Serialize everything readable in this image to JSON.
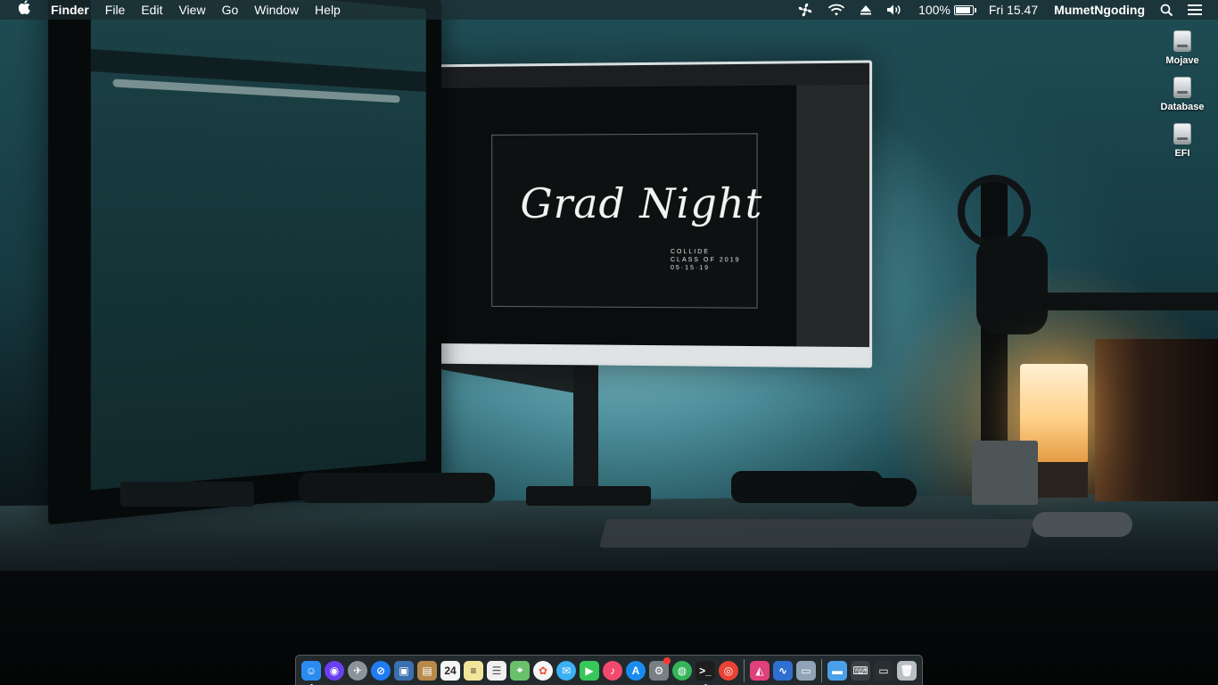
{
  "menubar": {
    "apple_icon": "apple-icon",
    "app_name": "Finder",
    "menus": [
      "File",
      "Edit",
      "View",
      "Go",
      "Window",
      "Help"
    ],
    "status": {
      "battery_percent": "100%",
      "clock": "Fri 15.47",
      "user": "MumetNgoding"
    }
  },
  "desktop": {
    "icons": [
      {
        "label": "Mojave",
        "icon": "hard-drive-icon"
      },
      {
        "label": "Database",
        "icon": "hard-drive-icon"
      },
      {
        "label": "EFI",
        "icon": "hard-drive-icon"
      }
    ]
  },
  "wallpaper": {
    "headline": "Grad Night",
    "line1": "COLLIDE",
    "line2": "CLASS OF 2019",
    "line3": "05·15·19"
  },
  "dock": {
    "apps": [
      {
        "name": "finder",
        "color": "#2b8cf0",
        "glyph": "☺",
        "running": true
      },
      {
        "name": "siri",
        "color": "#6a3ff0",
        "glyph": "◉",
        "round": true
      },
      {
        "name": "launchpad",
        "color": "#8b949b",
        "glyph": "✈",
        "round": true
      },
      {
        "name": "safari",
        "color": "#1f7bf2",
        "glyph": "⊘",
        "round": true
      },
      {
        "name": "preview",
        "color": "#3a6fb0",
        "glyph": "▣"
      },
      {
        "name": "contacts",
        "color": "#b88a4a",
        "glyph": "▤"
      },
      {
        "name": "calendar",
        "color": "#f5f5f5",
        "glyph": "24",
        "text_color": "#222"
      },
      {
        "name": "notes",
        "color": "#f2e59a",
        "glyph": "≡",
        "text_color": "#333"
      },
      {
        "name": "reminders",
        "color": "#f0f0f0",
        "glyph": "☰",
        "text_color": "#555"
      },
      {
        "name": "maps",
        "color": "#6bc06b",
        "glyph": "⌖"
      },
      {
        "name": "photos",
        "color": "#f5f5f5",
        "glyph": "✿",
        "text_color": "#e8533a",
        "round": true
      },
      {
        "name": "messages",
        "color": "#3ab0f5",
        "glyph": "✉",
        "round": true
      },
      {
        "name": "facetime",
        "color": "#38c85a",
        "glyph": "▶"
      },
      {
        "name": "itunes",
        "color": "#f24a6c",
        "glyph": "♪",
        "round": true
      },
      {
        "name": "app-store",
        "color": "#1a8cf0",
        "glyph": "A",
        "round": true
      },
      {
        "name": "system-preferences",
        "color": "#7a7f84",
        "glyph": "⚙",
        "badge": true
      },
      {
        "name": "stats",
        "color": "#35b45a",
        "glyph": "◍",
        "round": true
      },
      {
        "name": "terminal",
        "color": "#1e1e1e",
        "glyph": ">_",
        "running": true
      },
      {
        "name": "chrome",
        "color": "#e84335",
        "glyph": "◎",
        "round": true
      }
    ],
    "apps2": [
      {
        "name": "xscope",
        "color": "#e0407a",
        "glyph": "◭"
      },
      {
        "name": "activity-monitor",
        "color": "#2f6fd1",
        "glyph": "∿"
      },
      {
        "name": "image-viewer",
        "color": "#8fa4b8",
        "glyph": "▭"
      }
    ],
    "apps3": [
      {
        "name": "downloads-folder",
        "color": "#4aa0e8",
        "glyph": "▬"
      },
      {
        "name": "keyboard-viewer",
        "color": "#3a3f44",
        "glyph": "⌨"
      },
      {
        "name": "screen",
        "color": "#2a2e31",
        "glyph": "▭"
      },
      {
        "name": "trash",
        "color": "#b9bec2",
        "glyph": "🗑"
      }
    ]
  }
}
